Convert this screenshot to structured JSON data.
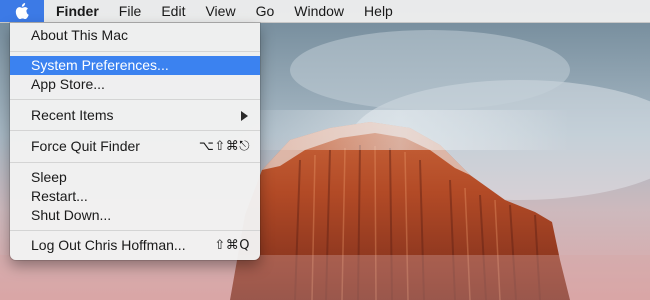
{
  "menubar": {
    "apple_icon": "apple-logo-icon",
    "items": [
      "Finder",
      "File",
      "Edit",
      "View",
      "Go",
      "Window",
      "Help"
    ]
  },
  "apple_menu": {
    "items": [
      {
        "label": "About This Mac",
        "shortcut": ""
      },
      {
        "label": "System Preferences...",
        "shortcut": "",
        "highlighted": true
      },
      {
        "label": "App Store...",
        "shortcut": ""
      },
      {
        "label": "Recent Items",
        "shortcut": "",
        "submenu": true
      },
      {
        "label": "Force Quit Finder",
        "shortcut": "⌥⇧⌘⎋"
      },
      {
        "label": "Sleep",
        "shortcut": ""
      },
      {
        "label": "Restart...",
        "shortcut": ""
      },
      {
        "label": "Shut Down...",
        "shortcut": ""
      },
      {
        "label": "Log Out Chris Hoffman...",
        "shortcut": "⇧⌘Q"
      }
    ]
  },
  "colors": {
    "highlight": "#3b82f0",
    "apple_button": "#3c7ae6"
  }
}
